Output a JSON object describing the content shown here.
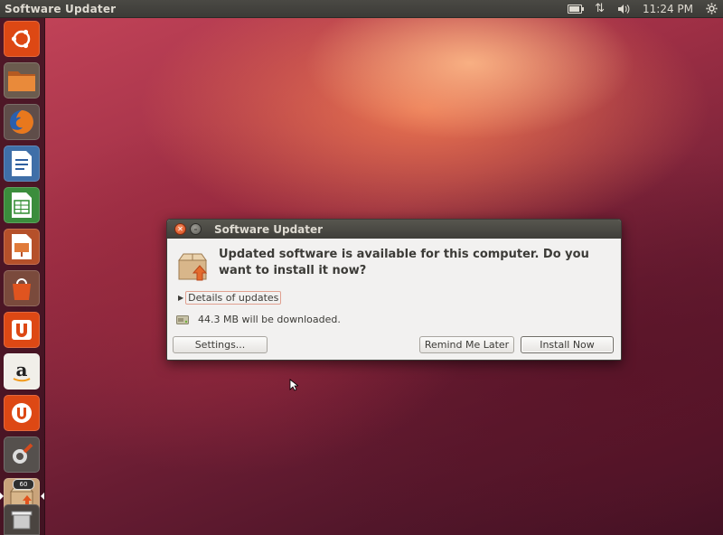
{
  "panel": {
    "app_title": "Software Updater",
    "time": "11:24 PM"
  },
  "launcher": {
    "items": [
      {
        "name": "dash-home",
        "icon": "ubuntu-logo-icon"
      },
      {
        "name": "files",
        "icon": "folder-icon"
      },
      {
        "name": "firefox",
        "icon": "firefox-icon"
      },
      {
        "name": "libreoffice-writer",
        "icon": "writer-icon"
      },
      {
        "name": "libreoffice-calc",
        "icon": "calc-icon"
      },
      {
        "name": "libreoffice-impress",
        "icon": "impress-icon"
      },
      {
        "name": "software-center",
        "icon": "shopping-bag-icon"
      },
      {
        "name": "ubuntu-one",
        "icon": "ubuntu-one-icon"
      },
      {
        "name": "amazon",
        "icon": "amazon-icon"
      },
      {
        "name": "ubuntu-one-music",
        "icon": "ubuntu-one-music-icon"
      },
      {
        "name": "system-settings",
        "icon": "settings-icon"
      },
      {
        "name": "software-updater",
        "icon": "package-update-icon",
        "badge": "60"
      },
      {
        "name": "trash",
        "icon": "trash-icon"
      }
    ]
  },
  "dialog": {
    "title": "Software Updater",
    "headline": "Updated software is available for this computer. Do you want to install it now?",
    "details_label": "Details of updates",
    "download_text": "44.3 MB will be downloaded.",
    "buttons": {
      "settings": "Settings...",
      "remind": "Remind Me Later",
      "install": "Install Now"
    }
  },
  "colors": {
    "panel_bg": "#3c3b37",
    "dialog_bg": "#f2f1f0",
    "close_button": "#e0541f",
    "accent_orange": "#dd4814"
  }
}
